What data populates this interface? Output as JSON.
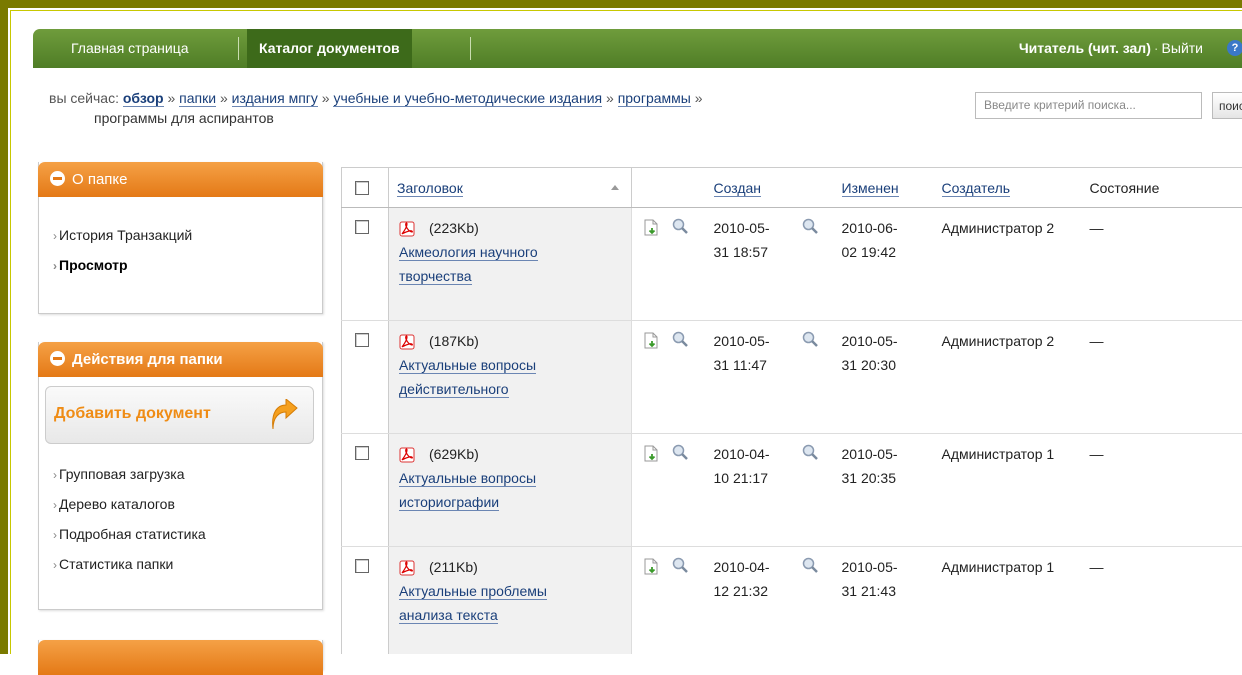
{
  "nav": {
    "home": "Главная страница",
    "catalog": "Каталог документов",
    "user": "Читатель (чит. зал)",
    "dot": "·",
    "logout": "Выйти",
    "help": "?"
  },
  "breadcrumb": {
    "prefix": "вы сейчас:",
    "items": [
      "обзор",
      "папки",
      "издания мпгу",
      "учебные и учебно-методические издания",
      "программы"
    ],
    "sep": "»",
    "current": "программы для аспирантов"
  },
  "search": {
    "placeholder": "Введите критерий поиска...",
    "button": "поиск"
  },
  "about_folder": {
    "title": "О папке",
    "items": [
      "История Транзакций",
      "Просмотр"
    ]
  },
  "folder_actions": {
    "title": "Действия для папки",
    "add": "Добавить документ",
    "items": [
      "Групповая загрузка",
      "Дерево каталогов",
      "Подробная статистика",
      "Статистика папки"
    ]
  },
  "table": {
    "headers": {
      "title": "Заголовок",
      "created": "Создан",
      "modified": "Изменен",
      "creator": "Создатель",
      "state": "Состояние"
    },
    "rows": [
      {
        "size": "(223Kb)",
        "title1": "Акмеология научного",
        "title2": "творчества",
        "c1": "2010-05-",
        "c2": "31 18:57",
        "m1": "2010-06-",
        "m2": "02 19:42",
        "creator": "Администратор 2",
        "state": "—"
      },
      {
        "size": "(187Kb)",
        "title1": "Актуальные вопросы",
        "title2": "действительного",
        "c1": "2010-05-",
        "c2": "31 11:47",
        "m1": "2010-05-",
        "m2": "31 20:30",
        "creator": "Администратор 2",
        "state": "—"
      },
      {
        "size": "(629Kb)",
        "title1": "Актуальные вопросы",
        "title2": "историографии",
        "c1": "2010-04-",
        "c2": "10 21:17",
        "m1": "2010-05-",
        "m2": "31 20:35",
        "creator": "Администратор 1",
        "state": "—"
      },
      {
        "size": "(211Kb)",
        "title1": "Актуальные проблемы",
        "title2": "анализа текста",
        "c1": "2010-04-",
        "c2": "12 21:32",
        "m1": "2010-05-",
        "m2": "31 21:43",
        "creator": "Администратор 1",
        "state": "—"
      }
    ]
  },
  "colors": {
    "nav": "#4f7d26",
    "accent": "#e47916",
    "link": "#1a3f7a"
  }
}
